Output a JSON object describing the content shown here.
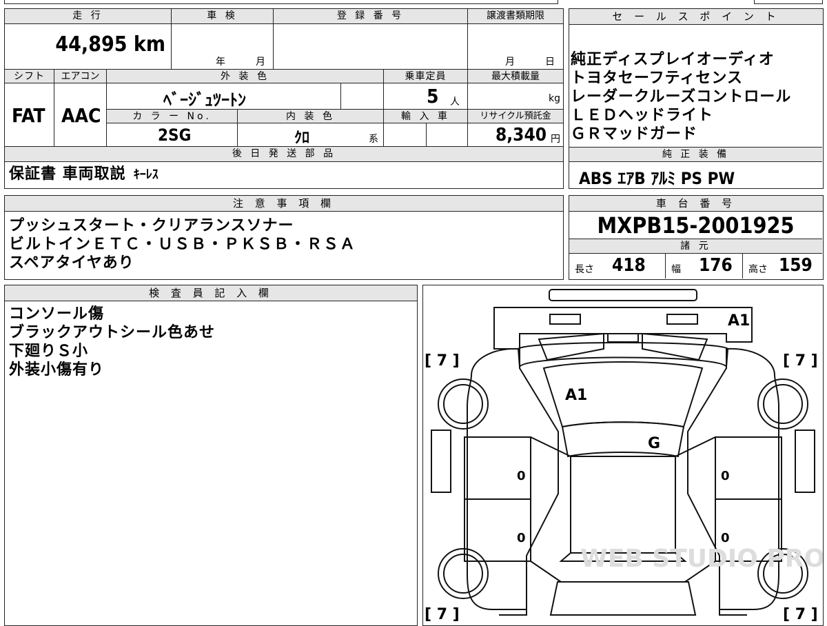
{
  "top": {
    "mileage_label": "走 行",
    "mileage_value": "44,895",
    "mileage_unit": "km",
    "inspection_label": "車 検",
    "inspection_year_unit": "年",
    "inspection_month_unit": "月",
    "registration_label": "登 録 番 号",
    "transfer_label": "譲渡書類期限",
    "transfer_month_unit": "月",
    "transfer_day_unit": "日"
  },
  "specs": {
    "shift_label": "シフト",
    "shift_value": "FAT",
    "ac_label": "エアコン",
    "ac_value": "AAC",
    "exterior_label": "外 装 色",
    "exterior_value": "ﾍﾞｰｼﾞｭﾂｰﾄﾝ",
    "capacity_label": "乗車定員",
    "capacity_value": "5",
    "capacity_unit": "人",
    "maxload_label": "最大積載量",
    "maxload_unit": "kg",
    "colorno_label": "カ ラ ー No.",
    "colorno_value": "2SG",
    "interior_label": "内 装 色",
    "interior_value": "ｸﾛ",
    "interior_suffix": "系",
    "import_label": "輸 入 車",
    "recycle_label": "リサイクル預託金",
    "recycle_value": "8,340",
    "recycle_unit": "円"
  },
  "later_parts": {
    "label": "後 日 発 送 部 品",
    "value_main": "保証書 車両取説",
    "value_sub": "ｷｰﾚｽ"
  },
  "sales_points": {
    "label": "セ ー ル ス ポ イ ン ト",
    "lines": [
      "純正ディスプレイオーディオ",
      "トヨタセーフティセンス",
      "レーダークルーズコントロール",
      "ＬＥＤヘッドライト",
      "ＧＲマッドガード"
    ]
  },
  "equipment": {
    "label": "純 正 装 備",
    "value": "ABS ｴｱB ｱﾙﾐ PS PW"
  },
  "notes": {
    "label": "注 意 事 項 欄",
    "lines": [
      "プッシュスタート・クリアランスソナー",
      "ビルトインＥＴＣ・ＵＳＢ・ＰＫＳＢ・ＲＳＡ",
      "スペアタイヤあり"
    ]
  },
  "chassis": {
    "label": "車 台 番 号",
    "value": "MXPB15-2001925",
    "dims_label": "諸 元",
    "length_label": "長さ",
    "length_value": "418",
    "width_label": "幅",
    "width_value": "176",
    "height_label": "高さ",
    "height_value": "159"
  },
  "inspector": {
    "label": "検 査 員 記 入 欄",
    "lines": [
      "コンソール傷",
      "ブラックアウトシール色あせ",
      "下廻りＳ小",
      "外装小傷有り"
    ]
  },
  "diagram": {
    "marks": [
      "A1",
      "A1",
      "G"
    ],
    "tire_marks": [
      "[ 7 ]",
      "[ 7 ]",
      "[ 7 ]",
      "[ 7 ]"
    ],
    "zeros": [
      "0",
      "0",
      "0",
      "0"
    ],
    "watermark": "WEB STUDIO PRO"
  }
}
